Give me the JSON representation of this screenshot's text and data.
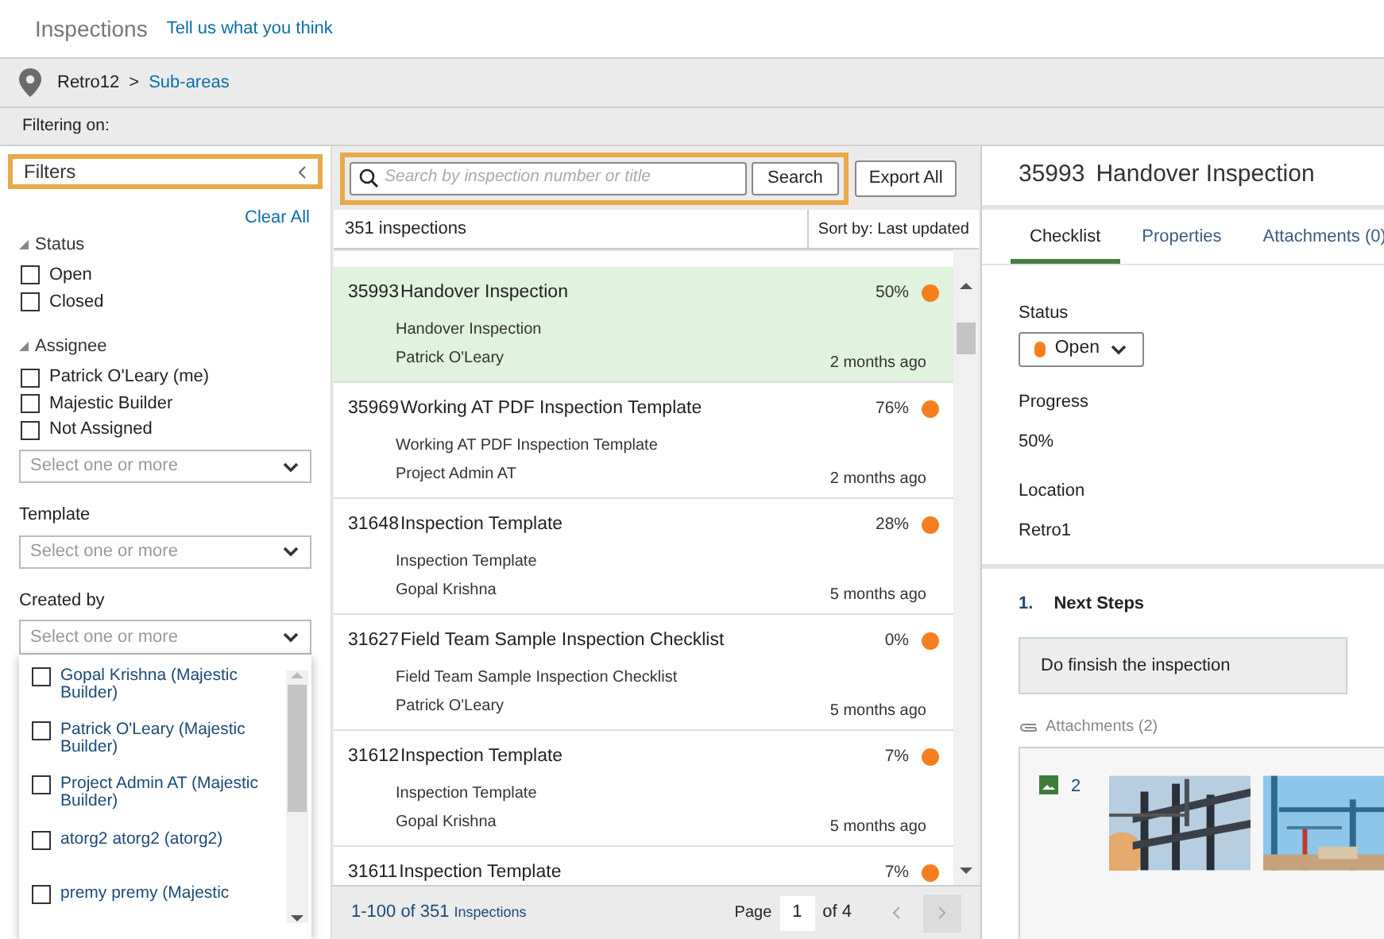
{
  "header": {
    "title": "Inspections",
    "feedback_link": "Tell us what you think"
  },
  "breadcrumb": {
    "parent": "Retro12",
    "separator": ">",
    "current": "Sub-areas"
  },
  "filter_bar": {
    "label": "Filtering on:"
  },
  "filters": {
    "title": "Filters",
    "clear_all": "Clear All",
    "sections": [
      {
        "kind": "checkboxes",
        "title": "Status",
        "expanded": true,
        "options": [
          {
            "label": "Open",
            "checked": false
          },
          {
            "label": "Closed",
            "checked": false
          }
        ]
      },
      {
        "kind": "checkboxes",
        "title": "Assignee",
        "expanded": true,
        "options": [
          {
            "label": "Patrick O'Leary (me)",
            "checked": false
          },
          {
            "label": "Majestic Builder",
            "checked": false
          },
          {
            "label": "Not Assigned",
            "checked": false
          }
        ],
        "placeholder": "Select one or more"
      },
      {
        "kind": "select",
        "title": "Template",
        "placeholder": "Select one or more"
      },
      {
        "kind": "select",
        "title": "Created by",
        "placeholder": "Select one or more",
        "options": [
          {
            "label": "Gopal Krishna (Majestic Builder)",
            "checked": false
          },
          {
            "label": "Patrick O'Leary (Majestic Builder)",
            "checked": false
          },
          {
            "label": "Project Admin AT (Majestic Builder)",
            "checked": false
          },
          {
            "label": "atorg2 atorg2 (atorg2)",
            "checked": false
          },
          {
            "label": "premy premy (Majestic",
            "checked": false
          }
        ]
      }
    ]
  },
  "search": {
    "placeholder": "Search by inspection number or title",
    "button": "Search"
  },
  "export_button": "Export All",
  "list_header": {
    "count": "351 inspections",
    "sort": "Sort by: Last updated"
  },
  "inspections": [
    {
      "number": "35993",
      "title": "Handover Inspection",
      "template": "Handover Inspection",
      "assignee": "Patrick O'Leary",
      "progress": "50%",
      "updated": "2 months ago",
      "color": "#f57f20",
      "selected": true
    },
    {
      "number": "35969",
      "title": "Working AT PDF Inspection Template",
      "template": "Working AT PDF Inspection Template",
      "assignee": "Project Admin AT",
      "progress": "76%",
      "updated": "2 months ago",
      "color": "#f57f20",
      "selected": false
    },
    {
      "number": "31648",
      "title": "Inspection Template",
      "template": "Inspection Template",
      "assignee": "Gopal Krishna",
      "progress": "28%",
      "updated": "5 months ago",
      "color": "#f57f20",
      "selected": false
    },
    {
      "number": "31627",
      "title": "Field Team Sample Inspection Checklist",
      "template": "Field Team Sample Inspection Checklist",
      "assignee": "Patrick O'Leary",
      "progress": "0%",
      "updated": "5 months ago",
      "color": "#f57f20",
      "selected": false
    },
    {
      "number": "31612",
      "title": "Inspection Template",
      "template": "Inspection Template",
      "assignee": "Gopal Krishna",
      "progress": "7%",
      "updated": "5 months ago",
      "color": "#f57f20",
      "selected": false
    },
    {
      "number": "31611",
      "title": "Inspection Template",
      "progress": "7%",
      "color": "#f57f20",
      "selected": false
    }
  ],
  "pagination": {
    "range": "1-100 of 351",
    "unit": "Inspections",
    "page_label": "Page",
    "page": "1",
    "total": "of 4"
  },
  "detail": {
    "number": "35993",
    "title": "Handover Inspection",
    "tabs": [
      {
        "label": "Checklist",
        "selected": true
      },
      {
        "label": "Properties",
        "selected": false
      },
      {
        "label": "Attachments (0)",
        "selected": false
      }
    ],
    "status_label": "Status",
    "status": {
      "value": "Open",
      "kind": "open"
    },
    "progress_label": "Progress",
    "progress": "50%",
    "location_label": "Location",
    "location": "Retro1",
    "checklist": [
      {
        "number": "1.",
        "title": "Next Steps",
        "answer": "Do finsish the inspection",
        "attachments_label": "Attachments (2)",
        "image_count": "2"
      }
    ]
  }
}
